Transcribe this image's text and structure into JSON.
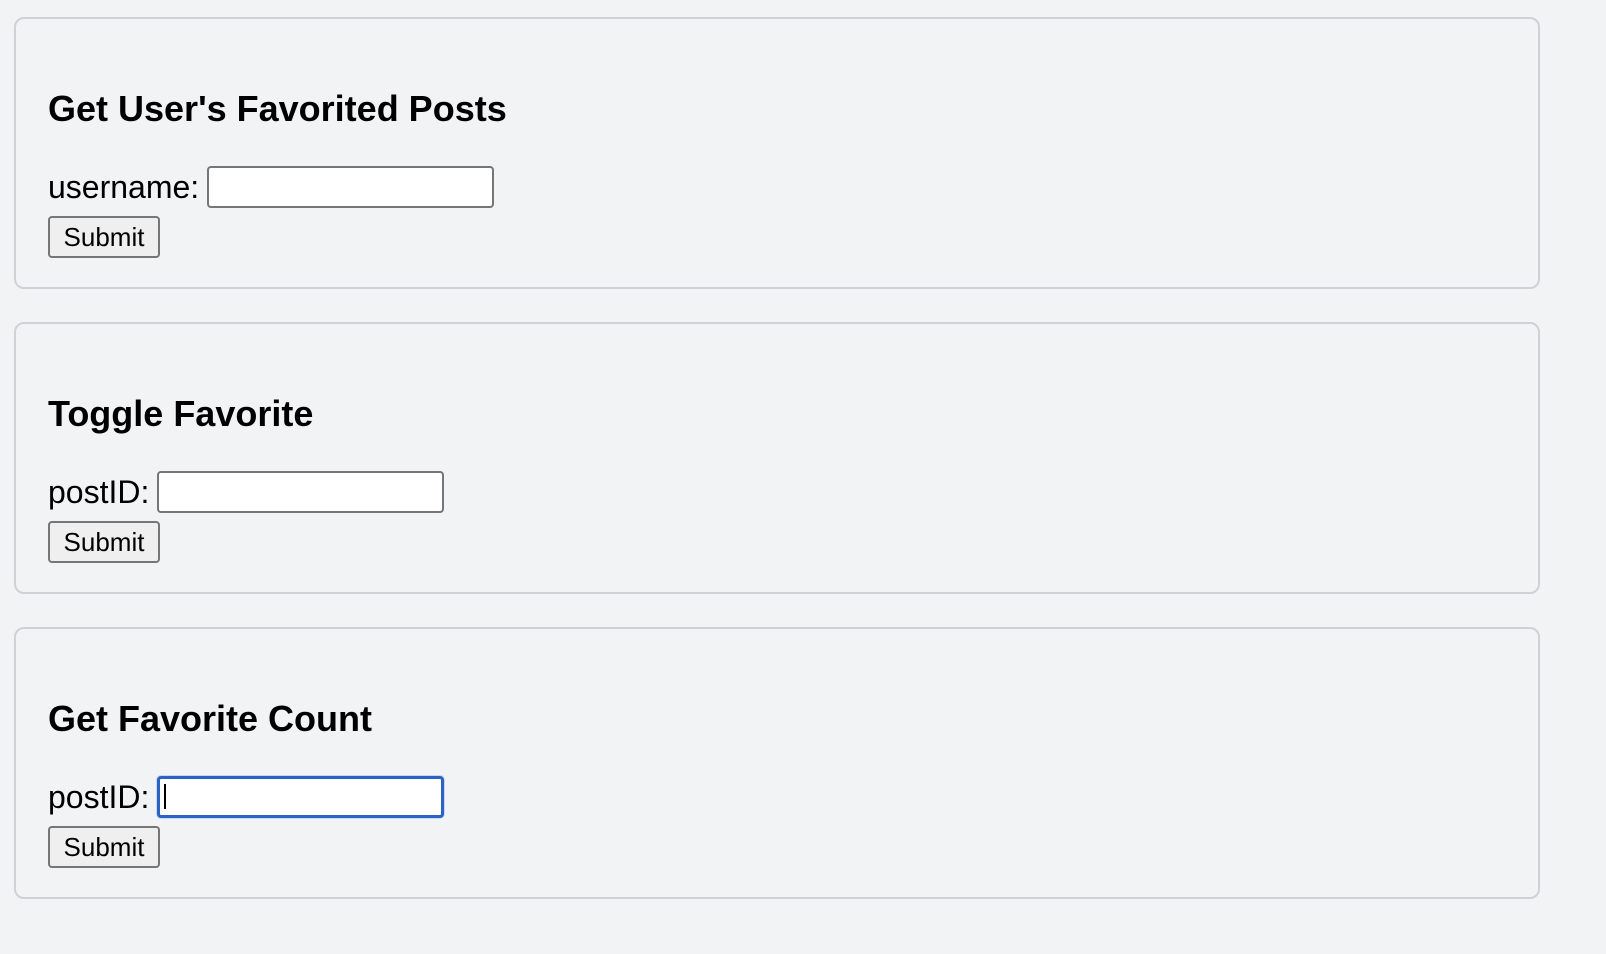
{
  "forms": [
    {
      "title": "Get User's Favorited Posts",
      "field_label": "username:",
      "field_value": "",
      "submit_label": "Submit"
    },
    {
      "title": "Toggle Favorite",
      "field_label": "postID:",
      "field_value": "",
      "submit_label": "Submit"
    },
    {
      "title": "Get Favorite Count",
      "field_label": "postID:",
      "field_value": "",
      "submit_label": "Submit",
      "focused": true
    }
  ],
  "colors": {
    "page_background": "#f2f3f5",
    "card_border": "#cfd1d4",
    "focus_ring": "#2a63c1"
  }
}
